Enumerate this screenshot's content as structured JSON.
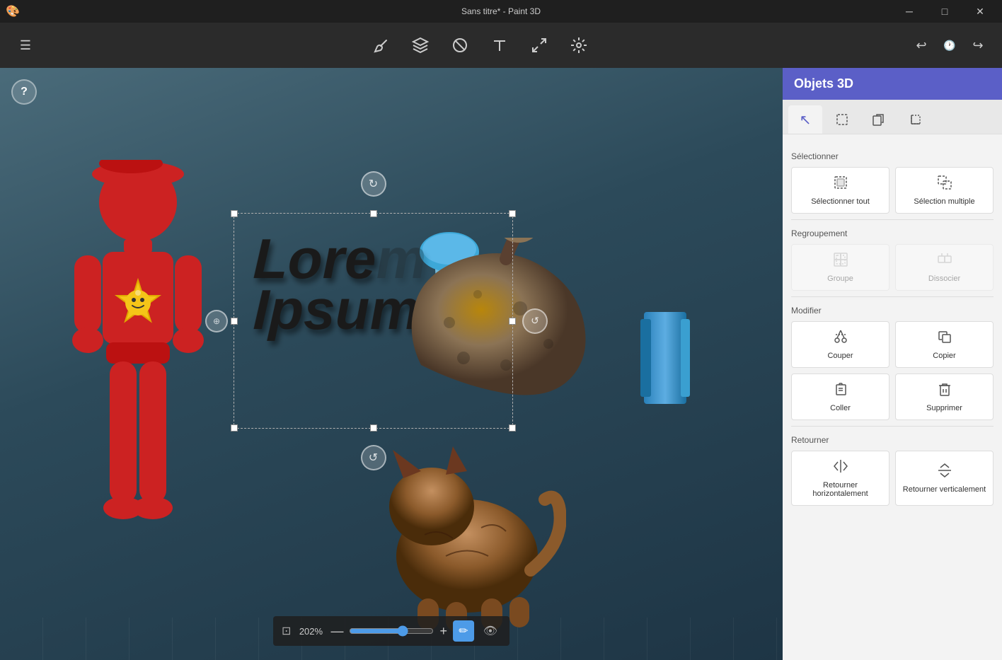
{
  "titlebar": {
    "title": "Sans titre* - Paint 3D",
    "min_label": "─",
    "max_label": "□",
    "close_label": "✕"
  },
  "toolbar": {
    "menu_icon": "☰",
    "tools": [
      {
        "name": "brush",
        "icon": "✏️"
      },
      {
        "name": "3d-objects",
        "icon": "⬡"
      },
      {
        "name": "eraser",
        "icon": "⊘"
      },
      {
        "name": "text",
        "icon": "T"
      },
      {
        "name": "resize",
        "icon": "⤡"
      },
      {
        "name": "effects",
        "icon": "✺"
      }
    ],
    "undo_icon": "↩",
    "history_icon": "🕐",
    "redo_icon": "↪"
  },
  "canvas": {
    "help_text": "?",
    "zoom_level": "202%",
    "zoom_min": "—",
    "zoom_plus": "+"
  },
  "panel": {
    "title": "Objets 3D",
    "tabs": [
      {
        "name": "select",
        "icon": "↖"
      },
      {
        "name": "select-region",
        "icon": "⬚"
      },
      {
        "name": "copy",
        "icon": "⧉"
      },
      {
        "name": "crop",
        "icon": "⊡"
      }
    ],
    "sections": {
      "select": {
        "label": "Sélectionner",
        "buttons": [
          {
            "id": "select-all",
            "label": "Sélectionner tout",
            "icon": "⬚"
          },
          {
            "id": "select-multiple",
            "label": "Sélection multiple",
            "icon": "⬚⬚"
          }
        ]
      },
      "group": {
        "label": "Regroupement",
        "buttons": [
          {
            "id": "group",
            "label": "Groupe",
            "icon": "⊞",
            "disabled": true
          },
          {
            "id": "ungroup",
            "label": "Dissocier",
            "icon": "⊟",
            "disabled": true
          }
        ]
      },
      "modify": {
        "label": "Modifier",
        "buttons_row1": [
          {
            "id": "cut",
            "label": "Couper",
            "icon": "✂"
          },
          {
            "id": "copy",
            "label": "Copier",
            "icon": "⧉"
          }
        ],
        "buttons_row2": [
          {
            "id": "paste",
            "label": "Coller",
            "icon": "📋"
          },
          {
            "id": "delete",
            "label": "Supprimer",
            "icon": "🗑"
          }
        ]
      },
      "flip": {
        "label": "Retourner",
        "buttons": [
          {
            "id": "flip-h",
            "label": "Retourner horizontalement",
            "icon": "⇔"
          },
          {
            "id": "flip-v",
            "label": "Retourner verticalement",
            "icon": "⇕"
          }
        ]
      }
    }
  }
}
